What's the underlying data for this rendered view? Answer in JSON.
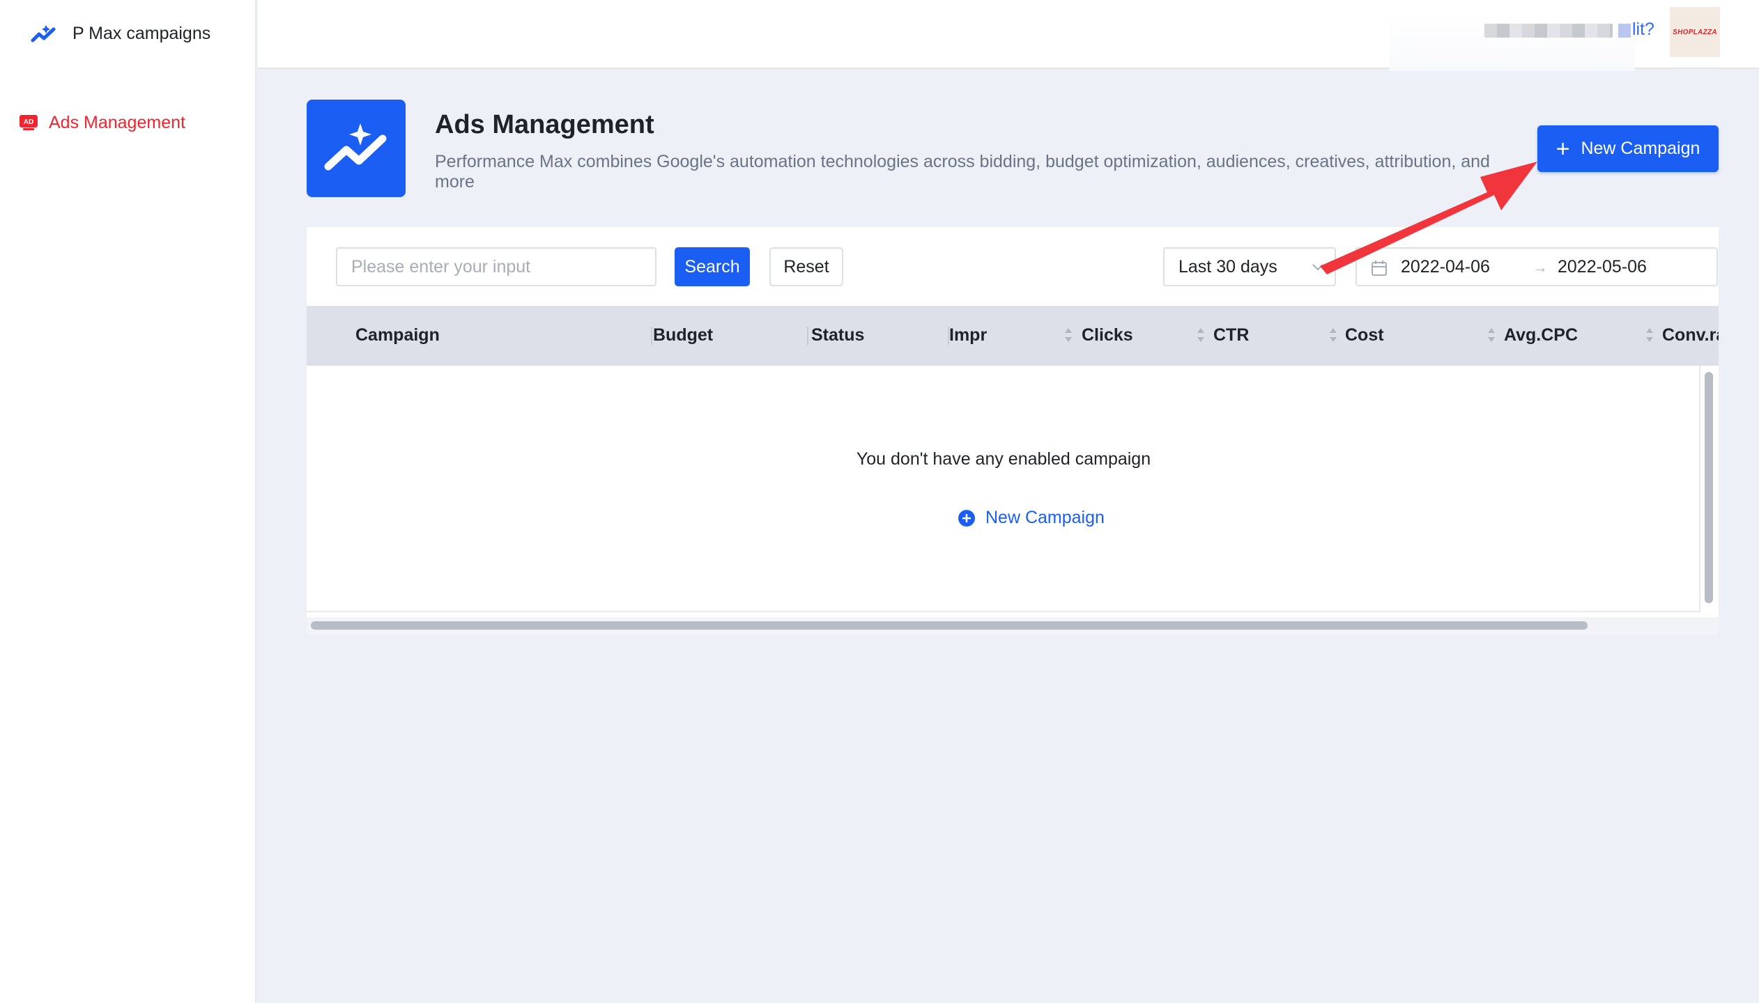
{
  "app": {
    "title": "P Max campaigns"
  },
  "sidebar": {
    "items": [
      {
        "label": "Ads Management",
        "icon": "ad-badge-icon",
        "active": true
      }
    ]
  },
  "header": {
    "link_text": "lit?",
    "avatar_text": "SHOPLAZZA"
  },
  "page": {
    "title": "Ads Management",
    "description": "Performance Max combines Google's automation technologies across bidding, budget optimization, audiences, creatives, attribution, and more",
    "new_campaign_label": "New Campaign"
  },
  "filters": {
    "search_placeholder": "Please enter your input",
    "search_value": "",
    "search_label": "Search",
    "reset_label": "Reset",
    "range_value": "Last 30 days",
    "date_start": "2022-04-06",
    "date_end": "2022-05-06"
  },
  "table": {
    "columns": [
      "Campaign",
      "Budget",
      "Status",
      "Impr",
      "Clicks",
      "CTR",
      "Cost",
      "Avg.CPC",
      "Conv.ra"
    ],
    "rows": [],
    "empty_text": "You don't have any enabled campaign",
    "empty_link_label": "New Campaign"
  },
  "colors": {
    "primary": "#1a5ef4",
    "sidebar_active": "#f0252f",
    "page_bg": "#edf0f7",
    "annotation_arrow": "#f0363c"
  }
}
